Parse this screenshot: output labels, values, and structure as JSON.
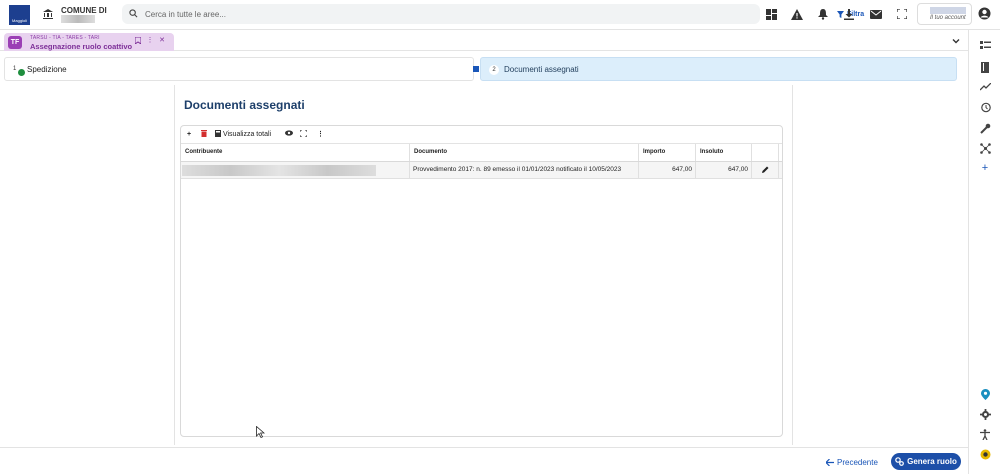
{
  "header": {
    "logo_text": "Maggioli",
    "municipality_label": "COMUNE DI",
    "search_placeholder": "Cerca in tutte le aree...",
    "filter_label": "Filtra",
    "account_label": "Il tuo account",
    "icons": [
      "dashboard-icon",
      "warning-icon",
      "bell-icon",
      "download-icon",
      "mail-icon",
      "fullscreen-icon",
      "user-icon"
    ]
  },
  "tab": {
    "badge": "TF",
    "subtitle": "TARSU - TIA - TARES - TARI",
    "title": "Assegnazione ruolo coattivo"
  },
  "stepper": {
    "steps": [
      {
        "number": "1",
        "label": "Spedizione",
        "status": "completed"
      },
      {
        "number": "2",
        "label": "Documenti assegnati",
        "status": "active"
      }
    ]
  },
  "main": {
    "title": "Documenti assegnati",
    "toolbar": {
      "add": "+",
      "show_totals": "Visualizza totali"
    },
    "columns": [
      "Contribuente",
      "Documento",
      "Importo",
      "Insoluto"
    ],
    "rows": [
      {
        "contribuente": "",
        "documento": "Provvedimento 2017: n. 89 emesso il 01/01/2023 notificato il 10/05/2023",
        "importo": "647,00",
        "insoluto": "647,00"
      }
    ]
  },
  "footer": {
    "prev_label": "Precedente",
    "generate_label": "Genera ruolo"
  },
  "rail": {
    "icons": [
      "list-icon",
      "book-icon",
      "trend-icon",
      "history-icon",
      "tools-icon",
      "network-icon",
      "plus-icon",
      "location-icon",
      "settings-icon",
      "accessibility-icon",
      "help-icon"
    ]
  },
  "colors": {
    "brand": "#1d4fa8",
    "tab_accent": "#9b3fb5",
    "step_active": "#dceefb",
    "success": "#1e8e3e"
  }
}
